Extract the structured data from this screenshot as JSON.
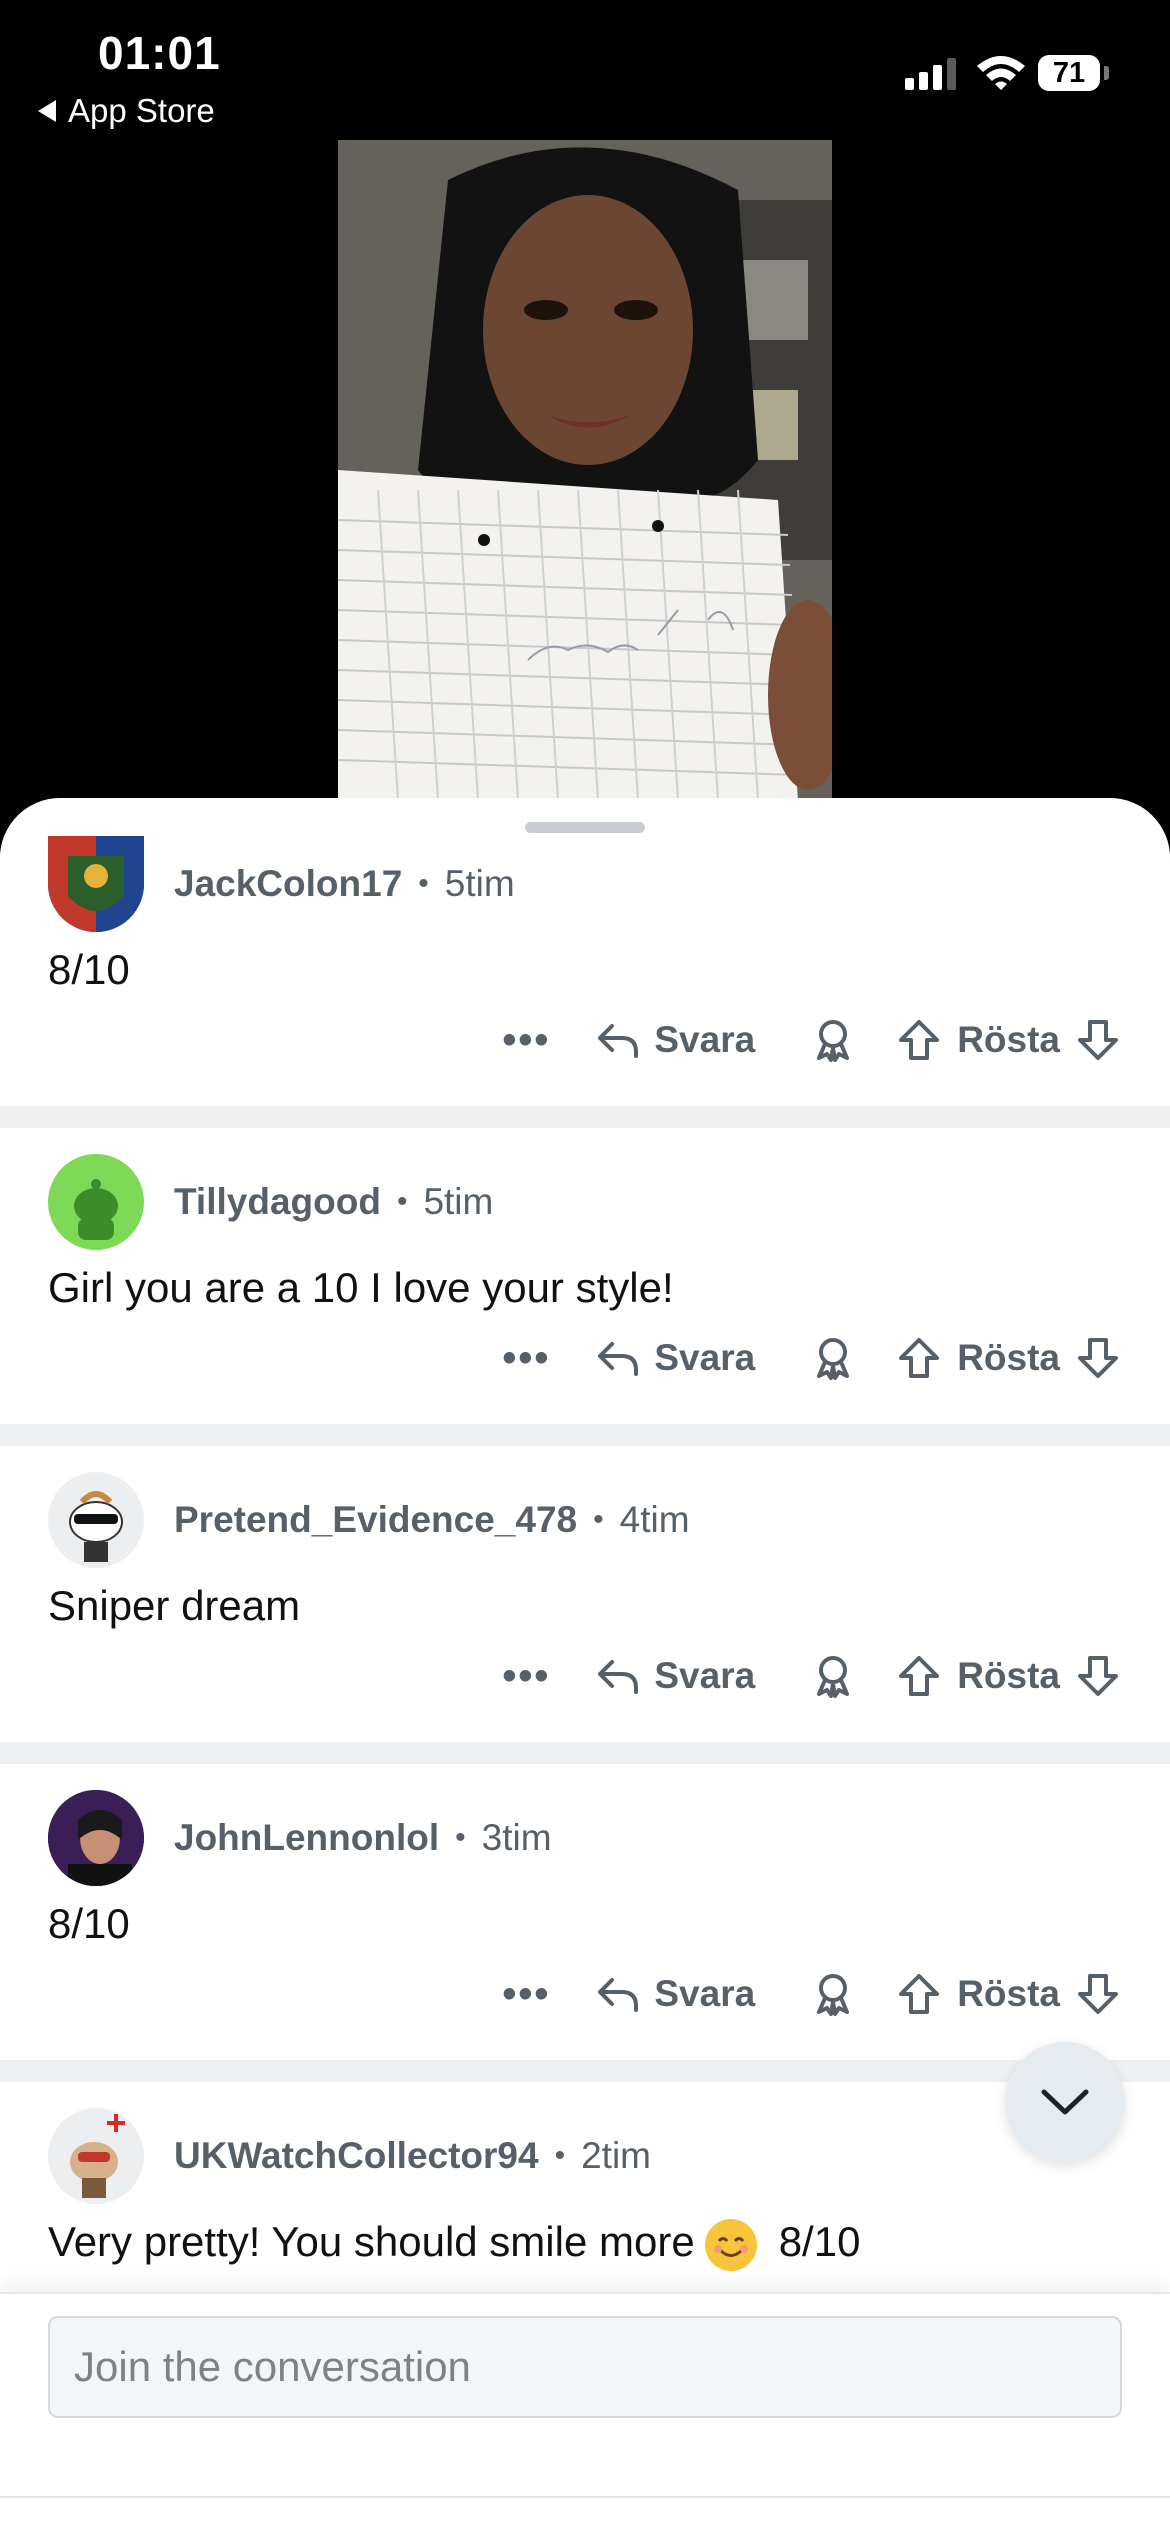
{
  "status_bar": {
    "time": "01:01",
    "back_label": "App Store",
    "battery": "71"
  },
  "comments": [
    {
      "user": "JackColon17",
      "age": "5tim",
      "text": "8/10"
    },
    {
      "user": "Tillydagood",
      "age": "5tim",
      "text": "Girl you are a 10 I love your style!"
    },
    {
      "user": "Pretend_Evidence_478",
      "age": "4tim",
      "text": "Sniper dream"
    },
    {
      "user": "JohnLennonlol",
      "age": "3tim",
      "text": "8/10"
    },
    {
      "user": "UKWatchCollector94",
      "age": "2tim",
      "text": "Very pretty! You should smile more",
      "text_suffix": "8/10"
    }
  ],
  "actions": {
    "more": "•••",
    "reply": "Svara",
    "vote": "Rösta"
  },
  "composer": {
    "placeholder": "Join the conversation"
  },
  "colors": {
    "meta": "#576068",
    "accent_fab": "#e6ebef"
  }
}
